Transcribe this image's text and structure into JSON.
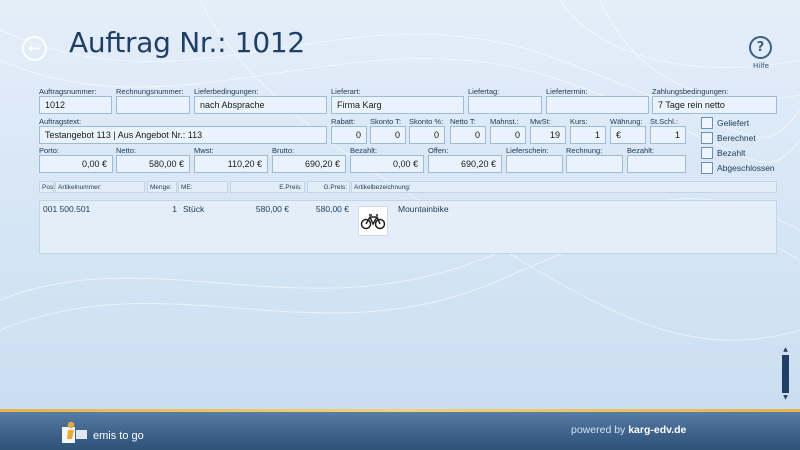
{
  "header": {
    "title": "Auftrag Nr.: 1012",
    "help_label": "Hilfe"
  },
  "form": {
    "row1": [
      {
        "label": "Auftragsnummer:",
        "value": "1012"
      },
      {
        "label": "Rechnungsnummer:",
        "value": ""
      },
      {
        "label": "Lieferbedingungen:",
        "value": "nach Absprache"
      },
      {
        "label": "Lieferart:",
        "value": "Firma Karg"
      },
      {
        "label": "Liefertag:",
        "value": ""
      },
      {
        "label": "Liefertermin:",
        "value": ""
      },
      {
        "label": "Zahlungsbedingungen:",
        "value": "7 Tage rein netto"
      }
    ],
    "row2": [
      {
        "label": "Auftragstext:",
        "value": "Testangebot 113 | Aus Angebot Nr.: 113"
      },
      {
        "label": "Rabatt:",
        "value": "0"
      },
      {
        "label": "Skonto T:",
        "value": "0"
      },
      {
        "label": "Skonto %:",
        "value": "0"
      },
      {
        "label": "Netto T:",
        "value": "0"
      },
      {
        "label": "Mahnst.:",
        "value": "0"
      },
      {
        "label": "MwSt:",
        "value": "19"
      },
      {
        "label": "Kurs:",
        "value": "1"
      },
      {
        "label": "Währung:",
        "value": "€"
      },
      {
        "label": "St.Schl.:",
        "value": "1"
      }
    ],
    "row3": [
      {
        "label": "Porto:",
        "value": "0,00 €"
      },
      {
        "label": "Netto:",
        "value": "580,00 €"
      },
      {
        "label": "Mwst:",
        "value": "110,20 €"
      },
      {
        "label": "Brutto:",
        "value": "690,20 €"
      },
      {
        "label": "Bezahlt:",
        "value": "0,00 €"
      },
      {
        "label": "Offen:",
        "value": "690,20 €"
      },
      {
        "label": "Lieferschein:",
        "value": ""
      },
      {
        "label": "Rechnung:",
        "value": ""
      },
      {
        "label": "Bezahlt:",
        "value": ""
      }
    ],
    "checkboxes": [
      "Geliefert",
      "Berechnet",
      "Bezahlt",
      "Abgeschlossen"
    ]
  },
  "table": {
    "columns": [
      "Pos:",
      "Artikelnummer:",
      "Menge:",
      "ME:",
      "E.Preis:",
      "G.Preis:",
      "Artikelbezeichnung:"
    ],
    "rows": [
      {
        "pos_artnr": "001 500.501",
        "menge": "1",
        "me": "Stück",
        "epreis": "580,00 €",
        "gpreis": "580,00 €",
        "thumbnail_icon": "bicycle-icon",
        "bezeichnung": "Mountainbike"
      }
    ]
  },
  "footer": {
    "logo_text": "emis to go",
    "powered_prefix": "powered by",
    "powered_brand": "karg-edv.de"
  },
  "colors": {
    "accent": "#1f3f66",
    "footer_bar": "#3c618a",
    "footer_stripe": "#e6b24a"
  }
}
